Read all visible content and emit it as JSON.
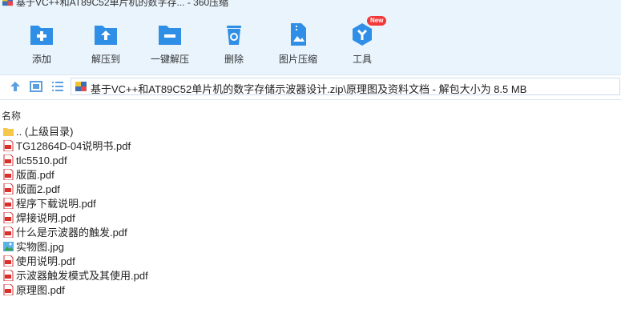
{
  "window": {
    "title": "基于VC++和AT89C52单片机的数字存... - 360压缩"
  },
  "toolbar": {
    "items": [
      {
        "label": "添加",
        "icon": "add-icon"
      },
      {
        "label": "解压到",
        "icon": "extract-to-icon"
      },
      {
        "label": "一键解压",
        "icon": "one-click-extract-icon"
      },
      {
        "label": "删除",
        "icon": "delete-icon"
      },
      {
        "label": "图片压缩",
        "icon": "image-compress-icon"
      },
      {
        "label": "工具",
        "icon": "tools-icon",
        "badge": "New"
      }
    ],
    "accent": "#2f8ee6",
    "badge_color": "#f23838"
  },
  "addressbar": {
    "path": "基于VC++和AT89C52单片机的数字存储示波器设计.zip\\原理图及资料文档 - 解包大小为 8.5 MB"
  },
  "list": {
    "column_name": "名称",
    "files": [
      {
        "name": ".. (上级目录)",
        "type": "folder"
      },
      {
        "name": "TG12864D-04说明书.pdf",
        "type": "pdf"
      },
      {
        "name": "tlc5510.pdf",
        "type": "pdf"
      },
      {
        "name": "版面.pdf",
        "type": "pdf"
      },
      {
        "name": "版面2.pdf",
        "type": "pdf"
      },
      {
        "name": "程序下载说明.pdf",
        "type": "pdf"
      },
      {
        "name": "焊接说明.pdf",
        "type": "pdf"
      },
      {
        "name": "什么是示波器的触发.pdf",
        "type": "pdf"
      },
      {
        "name": "实物图.jpg",
        "type": "image"
      },
      {
        "name": "使用说明.pdf",
        "type": "pdf"
      },
      {
        "name": "示波器触发模式及其使用.pdf",
        "type": "pdf"
      },
      {
        "name": "原理图.pdf",
        "type": "pdf"
      }
    ]
  }
}
